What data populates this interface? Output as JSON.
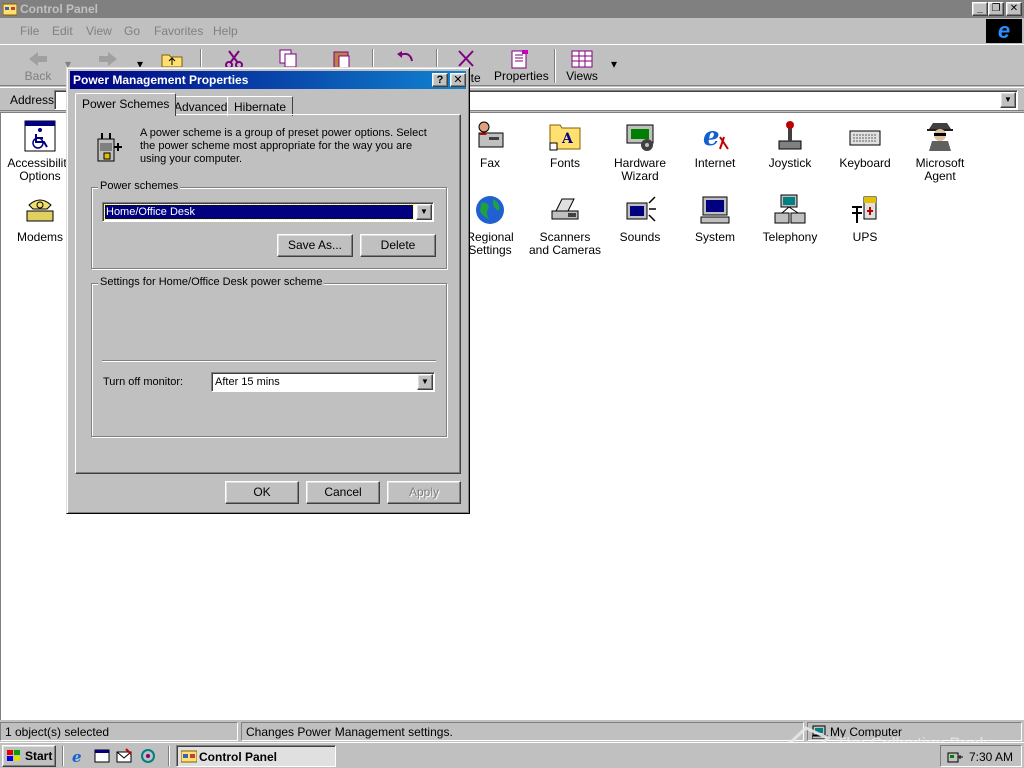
{
  "window": {
    "title": "Control Panel",
    "controls": {
      "minimize": "_",
      "restore": "❐",
      "close": "✕"
    }
  },
  "menu": [
    "File",
    "Edit",
    "View",
    "Go",
    "Favorites",
    "Help"
  ],
  "toolbar": {
    "back": "Back",
    "delete": "ete",
    "properties": "Properties",
    "views": "Views"
  },
  "address": {
    "label": "Address"
  },
  "items": [
    {
      "label": "Accessibility Options",
      "icon": "accessibility-icon"
    },
    {
      "label": "Fax",
      "icon": "fax-icon"
    },
    {
      "label": "Fonts",
      "icon": "fonts-icon"
    },
    {
      "label": "Hardware Wizard",
      "icon": "hardware-wizard-icon"
    },
    {
      "label": "Internet",
      "icon": "internet-icon"
    },
    {
      "label": "Joystick",
      "icon": "joystick-icon"
    },
    {
      "label": "Keyboard",
      "icon": "keyboard-icon"
    },
    {
      "label": "Microsoft Agent",
      "icon": "microsoft-agent-icon"
    },
    {
      "label": "Modems",
      "icon": "modems-icon"
    },
    {
      "label": "Regional Settings",
      "icon": "globe-icon"
    },
    {
      "label": "Scanners and Cameras",
      "icon": "scanner-icon"
    },
    {
      "label": "Sounds",
      "icon": "sounds-icon"
    },
    {
      "label": "System",
      "icon": "system-icon"
    },
    {
      "label": "Telephony",
      "icon": "telephony-icon"
    },
    {
      "label": "UPS",
      "icon": "ups-icon"
    }
  ],
  "status": {
    "selected": "1 object(s) selected",
    "description": "Changes Power Management settings.",
    "zone": "My Computer"
  },
  "watermark": "The Collection Book",
  "taskbar": {
    "start": "Start",
    "task": "Control Panel",
    "clock": "7:30 AM"
  },
  "dialog": {
    "title": "Power Management Properties",
    "help": "?",
    "close": "✕",
    "tabs": [
      "Power Schemes",
      "Advanced",
      "Hibernate"
    ],
    "description": "A power scheme is a group of preset power options. Select the power scheme most appropriate for the way you are using your computer.",
    "schemes_label": "Power schemes",
    "scheme_value": "Home/Office Desk",
    "save_as": "Save As...",
    "delete": "Delete",
    "settings_label": "Settings for Home/Office Desk power scheme",
    "monitor_label": "Turn off monitor:",
    "monitor_value": "After 15 mins",
    "ok": "OK",
    "cancel": "Cancel",
    "apply": "Apply"
  }
}
